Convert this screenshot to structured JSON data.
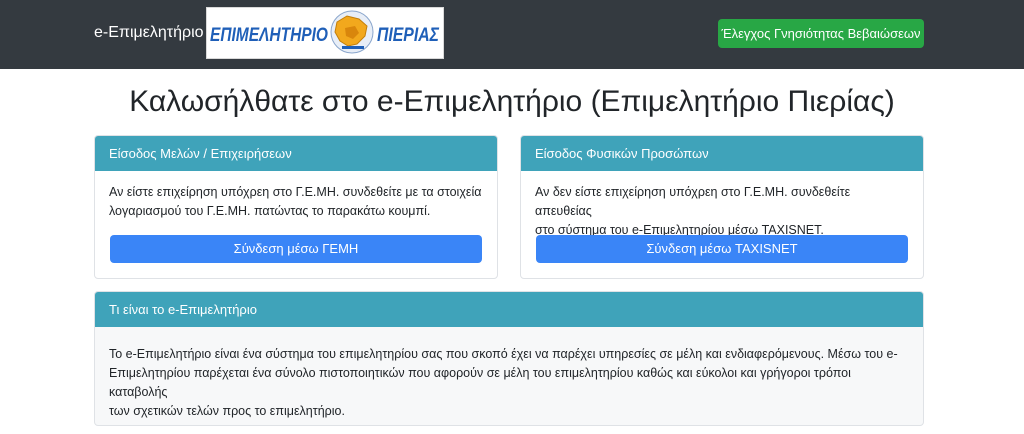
{
  "navbar": {
    "brand": "e-Επιμελητήριο",
    "logo_text_left": "ΕΠΙΜΕΛΗΤΗΡΙΟ",
    "logo_text_right": "ΠΙΕΡΙΑΣ",
    "verify_button": "Έλεγχος Γνησιότητας Βεβαιώσεων"
  },
  "page": {
    "title": "Καλωσήλθατε στο e-Επιμελητήριο (Επιμελητήριο Πιερίας)"
  },
  "members_card": {
    "header": "Είσοδος Μελών / Επιχειρήσεων",
    "line1": "Αν είστε επιχείρηση υπόχρεη στο Γ.Ε.ΜΗ. συνδεθείτε με τα στοιχεία",
    "line2": "λογαριασμού του Γ.Ε.ΜΗ. πατώντας το παρακάτω κουμπί.",
    "button": "Σύνδεση μέσω ΓΕΜΗ"
  },
  "persons_card": {
    "header": "Είσοδος Φυσικών Προσώπων",
    "line1": "Αν δεν είστε επιχείρηση υπόχρεη στο Γ.Ε.ΜΗ. συνδεθείτε απευθείας",
    "line2": "στο σύστημα του e-Επιμελητηρίου μέσω TAXISNET.",
    "button": "Σύνδεση μέσω TAXISNET"
  },
  "info_card": {
    "header": "Τι είναι το e-Επιμελητήριο",
    "line1": "Το e-Επιμελητήριο είναι ένα σύστημα του επιμελητηρίου σας που σκοπό έχει να παρέχει υπηρεσίες σε μέλη και ενδιαφερόμενους. Μέσω του e-",
    "line2": "Επιμελητηρίου παρέχεται ένα σύνολο πιστοποιητικών που αφορούν σε μέλη του επιμελητηρίου καθώς και εύκολοι και γρήγοροι τρόποι καταβολής",
    "line3": "των σχετικών τελών προς το επιμελητήριο."
  },
  "colors": {
    "navbar": "#343a40",
    "success": "#28a745",
    "card_header": "#3fa3ba",
    "primary_button": "#3a85f7"
  }
}
